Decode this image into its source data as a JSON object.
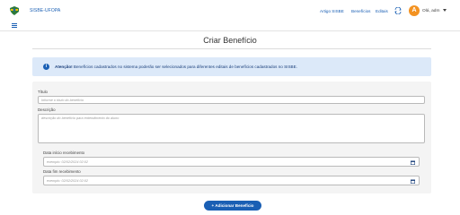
{
  "header": {
    "brand": "SISBE-UFOPA",
    "nav": [
      {
        "label": "Artigo SISBE"
      },
      {
        "label": "Benefícios"
      },
      {
        "label": "Editais"
      }
    ],
    "user": {
      "initial": "A",
      "greeting": "Olá, adm"
    }
  },
  "page": {
    "title": "Criar Benefício"
  },
  "alert": {
    "strong": "Atenção!",
    "text": " Benefícios cadastrados no sistema poderão ser selecionados para diferentes editais de benefícios cadastrados no SISBE."
  },
  "form": {
    "titulo": {
      "label": "Título",
      "placeholder": "Informe o título do benefício"
    },
    "descricao": {
      "label": "Descrição",
      "placeholder": "descrição do benefício para entendimento do aluno"
    },
    "data_inicio": {
      "label": "Data início recebimento",
      "placeholder": "exemplo: 02/02/2024 02:02"
    },
    "data_fim": {
      "label": "Data fim recebimento",
      "placeholder": "exemplo: 02/02/2024 02:02"
    },
    "submit_label": "+ Adicionar Benefício"
  },
  "colors": {
    "primary": "#1a5fb4",
    "avatar": "#f39221",
    "alert_bg": "#dce9f9",
    "panel_bg": "#f4f4f4"
  }
}
